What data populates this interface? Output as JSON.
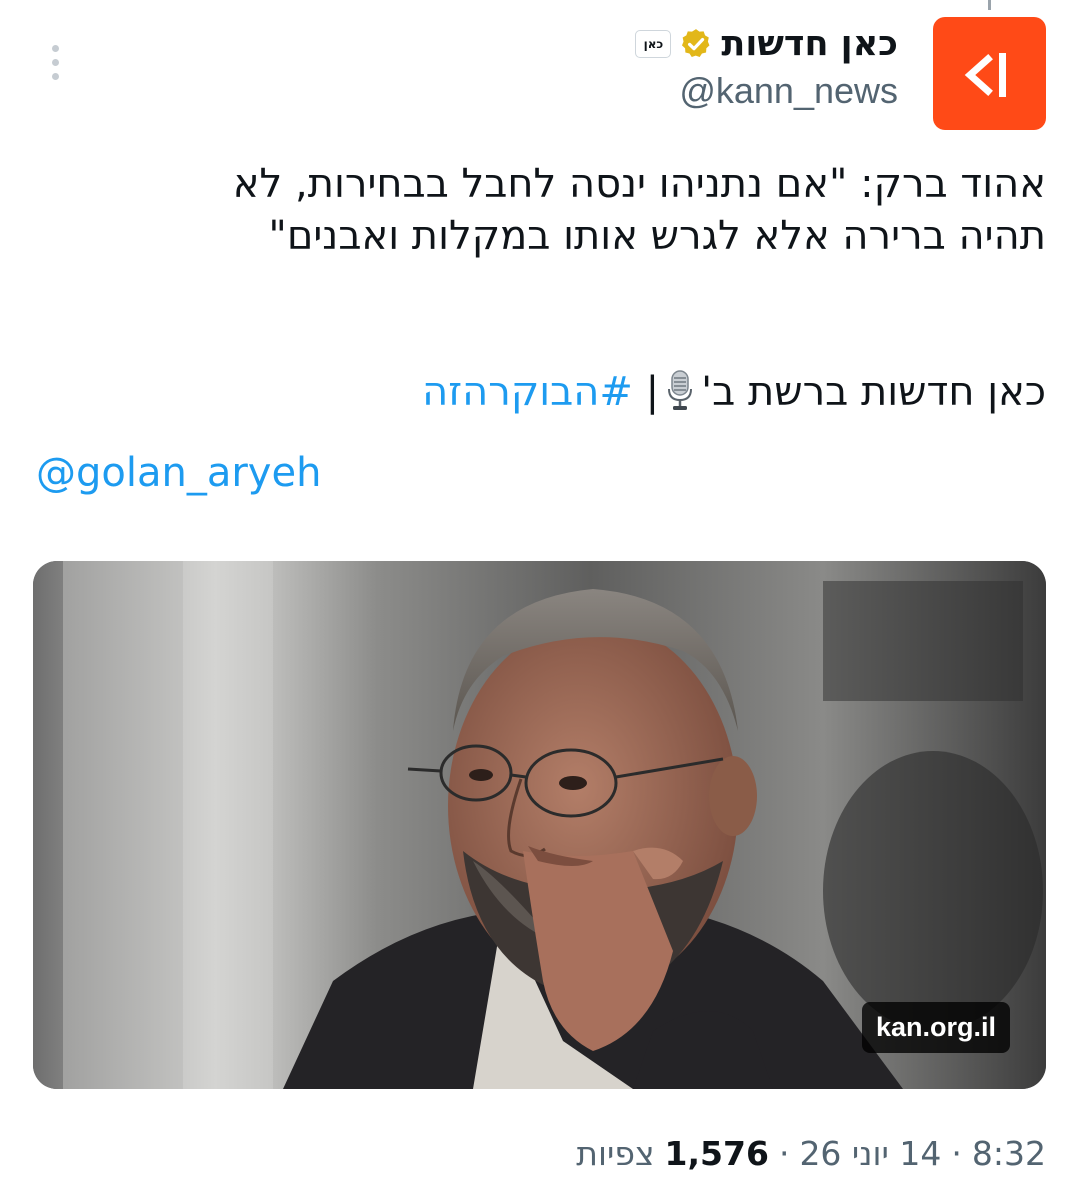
{
  "tweet": {
    "author": {
      "display_name": "כאן חדשות",
      "handle": "@kann_news",
      "affiliate_badge": "כאן",
      "avatar_color": "#ff4a17",
      "verified_color": "#e2b719"
    },
    "text": {
      "line1": "אהוד ברק: \"אם נתניהו ינסה לחבל בבחירות, לא",
      "line2": "תהיה ברירה אלא לגרש אותו במקלות ואבנים\"",
      "line3_prefix": "כאן חדשות ברשת ב'",
      "separator": "|",
      "hashtag": "#הבוקרהזה",
      "mention": "@golan_aryeh",
      "mic_icon": "studio-microphone-icon"
    },
    "media": {
      "link_domain": "kan.org.il"
    },
    "meta": {
      "time": "8:32",
      "date": "14 יוני 26",
      "separator": "·",
      "views_count": "1,576",
      "views_label": "צפיות"
    },
    "link_color": "#1d9bf0"
  }
}
